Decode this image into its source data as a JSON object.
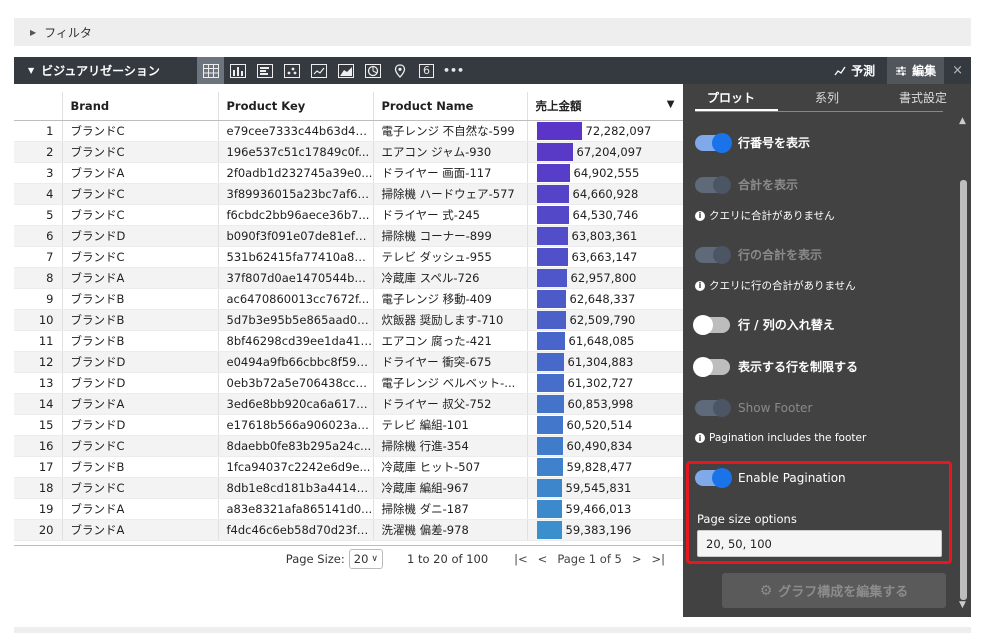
{
  "filter": {
    "label": "フィルタ"
  },
  "viz": {
    "title": "ビジュアリゼーション",
    "forecast": "予測",
    "edit": "編集",
    "close": "×",
    "icon_number": "6",
    "icon_more": "•••"
  },
  "table": {
    "headers": [
      "",
      "Brand",
      "Product Key",
      "Product Name",
      "売上金額"
    ],
    "rows": [
      {
        "n": "1",
        "brand": "ブランドC",
        "key": "e79cee7333c44b63d46...",
        "name": "電子レンジ 不自然な-599",
        "sales": "72,282,097",
        "v": 72282097
      },
      {
        "n": "2",
        "brand": "ブランドC",
        "key": "196e537c51c17849c0f...",
        "name": "エアコン ジャム-930",
        "sales": "67,204,097",
        "v": 67204097
      },
      {
        "n": "3",
        "brand": "ブランドA",
        "key": "2f0adb1d232745a39e0...",
        "name": "ドライヤー 画面-117",
        "sales": "64,902,555",
        "v": 64902555
      },
      {
        "n": "4",
        "brand": "ブランドC",
        "key": "3f89936015a23bc7af66...",
        "name": "掃除機 ハードウェア-577",
        "sales": "64,660,928",
        "v": 64660928
      },
      {
        "n": "5",
        "brand": "ブランドC",
        "key": "f6cbdc2bb96aece36b7...",
        "name": "ドライヤー 式-245",
        "sales": "64,530,746",
        "v": 64530746
      },
      {
        "n": "6",
        "brand": "ブランドD",
        "key": "b090f3f091e07de81ef6...",
        "name": "掃除機 コーナー-899",
        "sales": "63,803,361",
        "v": 63803361
      },
      {
        "n": "7",
        "brand": "ブランドC",
        "key": "531b62415fa77410a83...",
        "name": "テレビ ダッシュ-955",
        "sales": "63,663,147",
        "v": 63663147
      },
      {
        "n": "8",
        "brand": "ブランドA",
        "key": "37f807d0ae1470544b8...",
        "name": "冷蔵庫 スペル-726",
        "sales": "62,957,800",
        "v": 62957800
      },
      {
        "n": "9",
        "brand": "ブランドB",
        "key": "ac6470860013cc7672f...",
        "name": "電子レンジ 移動-409",
        "sales": "62,648,337",
        "v": 62648337
      },
      {
        "n": "10",
        "brand": "ブランドB",
        "key": "5d7b3e95b5e865aad0b...",
        "name": "炊飯器 奨励します-710",
        "sales": "62,509,790",
        "v": 62509790
      },
      {
        "n": "11",
        "brand": "ブランドB",
        "key": "8bf46298cd39ee1da41f...",
        "name": "エアコン 腐った-421",
        "sales": "61,648,085",
        "v": 61648085
      },
      {
        "n": "12",
        "brand": "ブランドD",
        "key": "e0494a9fb66cbbc8f593...",
        "name": "ドライヤー 衝突-675",
        "sales": "61,304,883",
        "v": 61304883
      },
      {
        "n": "13",
        "brand": "ブランドD",
        "key": "0eb3b72a5e706438cc4...",
        "name": "電子レンジ ベルベット-...",
        "sales": "61,302,727",
        "v": 61302727
      },
      {
        "n": "14",
        "brand": "ブランドA",
        "key": "3ed6e8bb920ca6a617e...",
        "name": "ドライヤー 叔父-752",
        "sales": "60,853,998",
        "v": 60853998
      },
      {
        "n": "15",
        "brand": "ブランドD",
        "key": "e17618b566a906023a6...",
        "name": "テレビ 編組-101",
        "sales": "60,520,514",
        "v": 60520514
      },
      {
        "n": "16",
        "brand": "ブランドC",
        "key": "8daebb0fe83b295a24c...",
        "name": "掃除機 行進-354",
        "sales": "60,490,834",
        "v": 60490834
      },
      {
        "n": "17",
        "brand": "ブランドB",
        "key": "1fca94037c2242e6d9e...",
        "name": "冷蔵庫 ヒット-507",
        "sales": "59,828,477",
        "v": 59828477
      },
      {
        "n": "18",
        "brand": "ブランドC",
        "key": "8db1e8cd181b3a4414e...",
        "name": "冷蔵庫 編組-967",
        "sales": "59,545,831",
        "v": 59545831
      },
      {
        "n": "19",
        "brand": "ブランドA",
        "key": "a83e8321afa865141d0...",
        "name": "掃除機 ダニ-187",
        "sales": "59,466,013",
        "v": 59466013
      },
      {
        "n": "20",
        "brand": "ブランドA",
        "key": "f4dc46c6eb58d70d23f4...",
        "name": "洗濯機 偏差-978",
        "sales": "59,383,196",
        "v": 59383196
      }
    ]
  },
  "pager": {
    "page_size_label": "Page Size:",
    "page_size_value": "20",
    "range": "1 to 20 of 100",
    "page_info": "Page 1 of 5"
  },
  "panel": {
    "tabs": [
      "プロット",
      "系列",
      "書式設定"
    ],
    "options": {
      "row_numbers": "行番号を表示",
      "totals": "合計を表示",
      "totals_note": "クエリに合計がありません",
      "row_totals": "行の合計を表示",
      "row_totals_note": "クエリに行の合計がありません",
      "transpose": "行 / 列の入れ替え",
      "limit_rows": "表示する行を制限する",
      "show_footer": "Show Footer",
      "footer_note": "Pagination includes the footer",
      "enable_pagination": "Enable Pagination",
      "page_size_options_label": "Page size options",
      "page_size_options_value": "20, 50, 100"
    },
    "edit_graph_button": "グラフ構成を編集する"
  },
  "colors": {
    "bar_top": "#5a35c7",
    "bar_bottom": "#3a8fcc",
    "highlight": "#e8171f",
    "toggle_on": "#1a73e8"
  }
}
